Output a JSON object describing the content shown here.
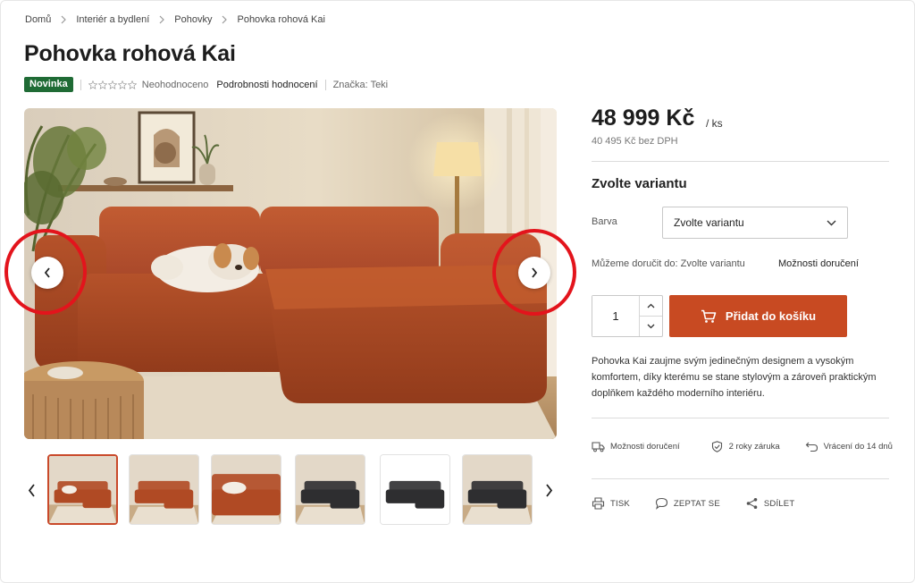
{
  "breadcrumb": [
    "Domů",
    "Interiér a bydlení",
    "Pohovky",
    "Pohovka rohová Kai"
  ],
  "product": {
    "title": "Pohovka rohová Kai",
    "badge": "Novinka",
    "rating_text": "Neohodnoceno",
    "rating_stars": 0,
    "rating_link": "Podrobnosti hodnocení",
    "brand": "Značka: Teki"
  },
  "price": {
    "amount": "48 999 Kč",
    "unit": "/ ks",
    "net": "40 495 Kč bez DPH"
  },
  "variant": {
    "heading": "Zvolte variantu",
    "color_label": "Barva",
    "select_value": "Zvolte variantu"
  },
  "delivery": {
    "text": "Můžeme doručit do: Zvolte variantu",
    "options_link": "Možnosti doručení"
  },
  "cart": {
    "quantity": "1",
    "button_label": "Přidat do košíku"
  },
  "description": "Pohovka Kai zaujme svým jedinečným designem a vysokým komfortem, díky kterému se stane stylovým a zároveň praktickým doplňkem každého moderního interiéru.",
  "features": [
    {
      "icon": "truck-icon",
      "label": "Možnosti doručení"
    },
    {
      "icon": "shield-check-icon",
      "label": "2 roky záruka"
    },
    {
      "icon": "return-arrow-icon",
      "label": "Vrácení do 14 dnů"
    }
  ],
  "actions": [
    {
      "icon": "printer-icon",
      "label": "TISK"
    },
    {
      "icon": "chat-bubble-icon",
      "label": "ZEPTAT SE"
    },
    {
      "icon": "share-icon",
      "label": "SDÍLET"
    }
  ],
  "gallery": {
    "thumbnail_count": 6,
    "active_index": 0,
    "thumbnails": [
      {
        "sofa_color": "#b04a24",
        "scene": "room-with-dog"
      },
      {
        "sofa_color": "#b04a24",
        "scene": "room"
      },
      {
        "sofa_color": "#b04a24",
        "scene": "closeup-with-dog"
      },
      {
        "sofa_color": "#2e2e30",
        "scene": "room"
      },
      {
        "sofa_color": "#2e2e30",
        "scene": "white-background"
      },
      {
        "sofa_color": "#2e2e30",
        "scene": "room"
      }
    ]
  },
  "colors": {
    "accent": "#c84a22",
    "badge_green": "#1f6b35",
    "annotation_red": "#e3141c"
  }
}
